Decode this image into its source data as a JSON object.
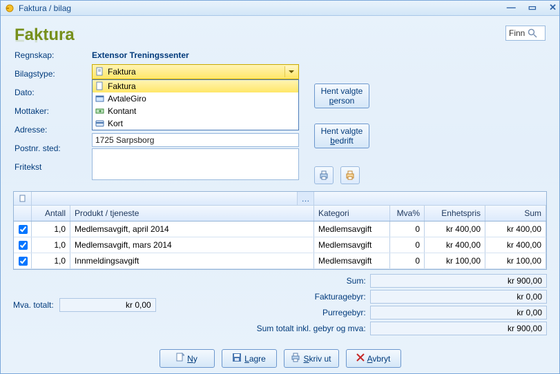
{
  "window": {
    "title": "Faktura / bilag"
  },
  "header": {
    "page_title": "Faktura",
    "find_label": "Finn"
  },
  "form": {
    "labels": {
      "regnskap": "Regnskap:",
      "bilagstype": "Bilagstype:",
      "dato": "Dato:",
      "mottaker": "Mottaker:",
      "adresse": "Adresse:",
      "postnr": "Postnr. sted:",
      "fritekst": "Fritekst"
    },
    "regnskap_value": "Extensor Treningssenter",
    "bilagstype_selected": "Faktura",
    "bilagstype_options": [
      "Faktura",
      "AvtaleGiro",
      "Kontant",
      "Kort"
    ],
    "postnr_value": "1725 Sarpsborg"
  },
  "buttons": {
    "hent_person": "Hent valgte person",
    "hent_person_u": "p",
    "hent_bedrift": "Hent valgte bedrift",
    "hent_bedrift_u": "b",
    "ny": "Ny",
    "lagre": "Lagre",
    "skriv_ut": "Skriv ut",
    "avbryt": "Avbryt"
  },
  "grid": {
    "headers": {
      "antall": "Antall",
      "produkt": "Produkt / tjeneste",
      "kategori": "Kategori",
      "mva": "Mva%",
      "enhetspris": "Enhetspris",
      "sum": "Sum"
    },
    "rows": [
      {
        "checked": true,
        "antall": "1,0",
        "produkt": "Medlemsavgift, april 2014",
        "kategori": "Medlemsavgift",
        "mva": "0",
        "enhetspris": "kr 400,00",
        "sum": "kr 400,00"
      },
      {
        "checked": true,
        "antall": "1,0",
        "produkt": "Medlemsavgift, mars 2014",
        "kategori": "Medlemsavgift",
        "mva": "0",
        "enhetspris": "kr 400,00",
        "sum": "kr 400,00"
      },
      {
        "checked": true,
        "antall": "1,0",
        "produkt": "Innmeldingsavgift",
        "kategori": "Medlemsavgift",
        "mva": "0",
        "enhetspris": "kr 100,00",
        "sum": "kr 100,00"
      }
    ]
  },
  "totals": {
    "mva_total_label": "Mva. totalt:",
    "mva_total": "kr 0,00",
    "rows": [
      {
        "label": "Sum:",
        "value": "kr 900,00"
      },
      {
        "label": "Fakturagebyr:",
        "value": "kr 0,00"
      },
      {
        "label": "Purregebyr:",
        "value": "kr 0,00"
      },
      {
        "label": "Sum totalt inkl. gebyr og mva:",
        "value": "kr 900,00"
      }
    ]
  }
}
